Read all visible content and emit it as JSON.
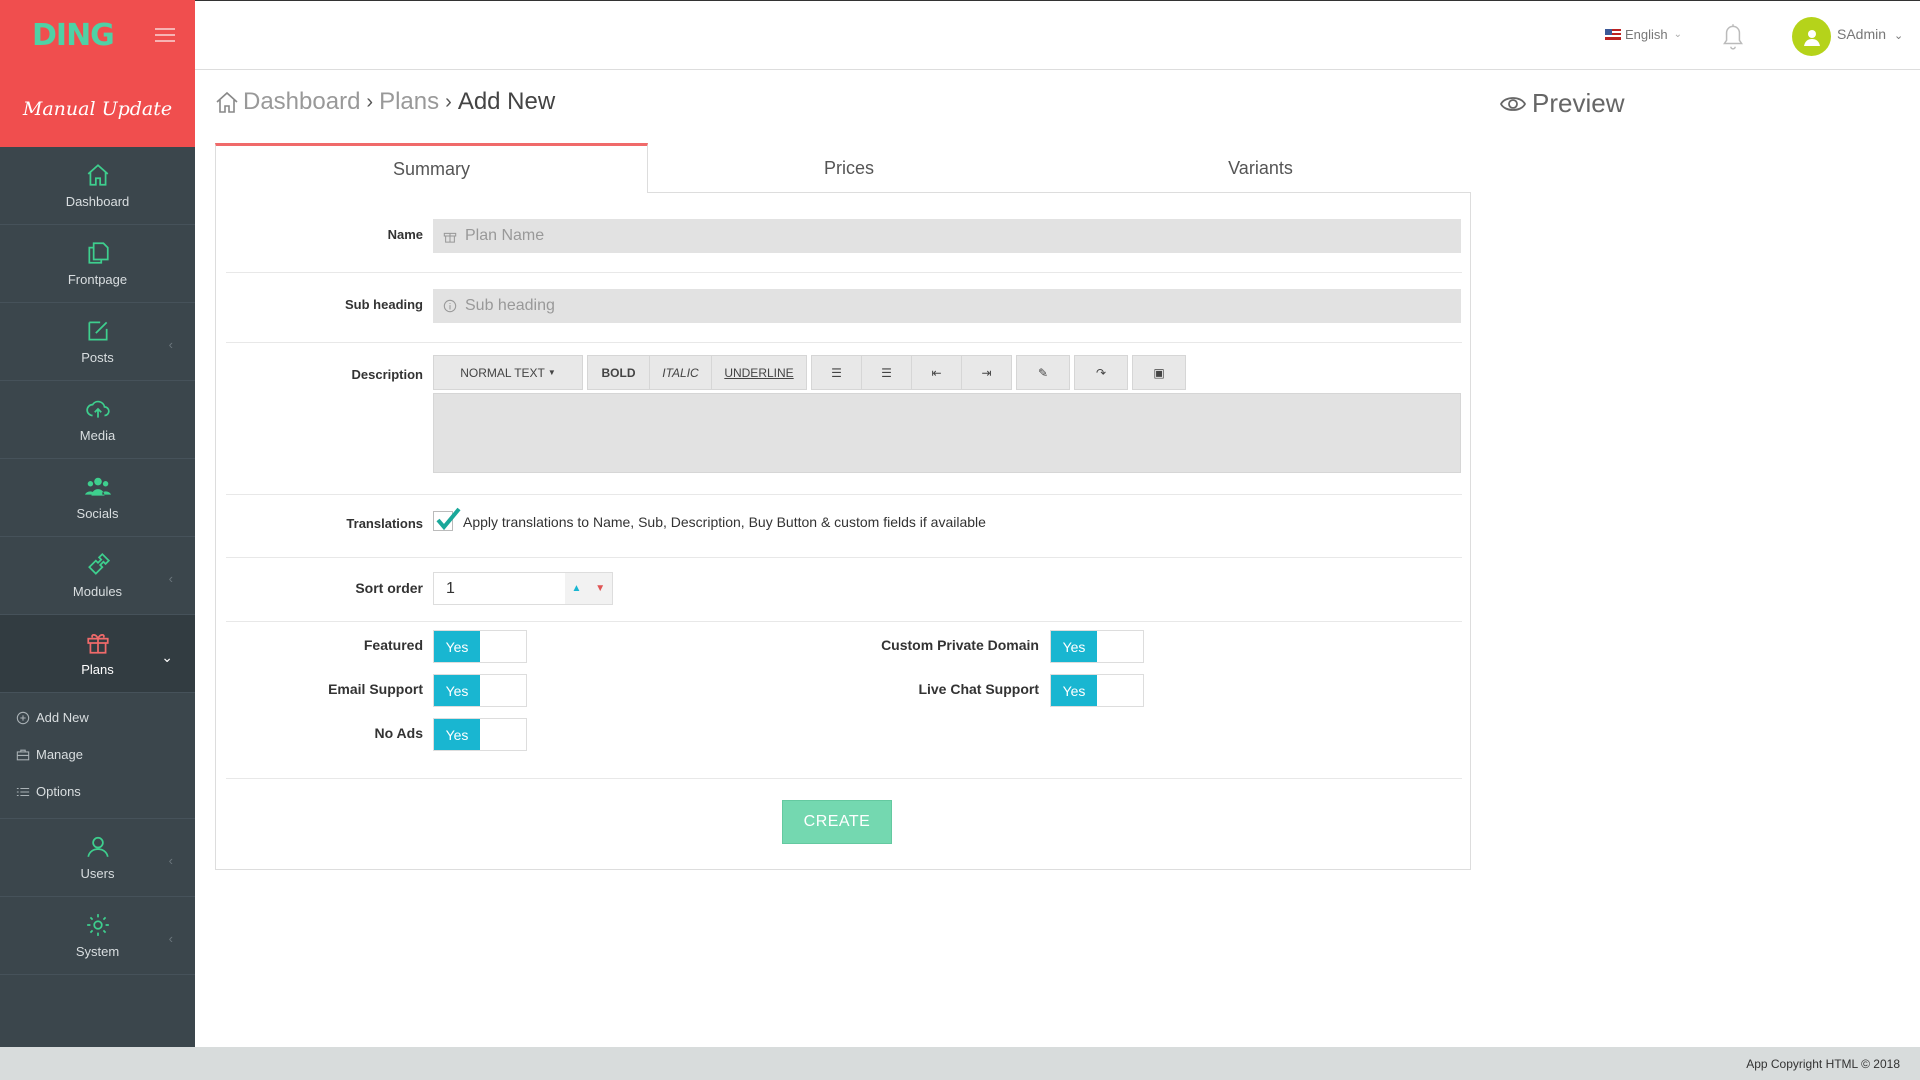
{
  "brand": {
    "logo": "DING",
    "banner": "Manual Update",
    "accent": "#f04e4e",
    "logo_color": "#4fd1a5"
  },
  "sidebar": {
    "items": [
      {
        "label": "Dashboard",
        "icon": "home-icon"
      },
      {
        "label": "Frontpage",
        "icon": "copy-icon"
      },
      {
        "label": "Posts",
        "icon": "edit-icon"
      },
      {
        "label": "Media",
        "icon": "cloud-upload-icon"
      },
      {
        "label": "Socials",
        "icon": "users-group-icon"
      },
      {
        "label": "Modules",
        "icon": "puzzle-icon"
      },
      {
        "label": "Plans",
        "icon": "gift-icon",
        "active": true
      },
      {
        "label": "Users",
        "icon": "user-icon"
      },
      {
        "label": "System",
        "icon": "gear-icon"
      }
    ],
    "plans_submenu": [
      {
        "label": "Add New",
        "icon": "plus-circle-icon"
      },
      {
        "label": "Manage",
        "icon": "briefcase-icon"
      },
      {
        "label": "Options",
        "icon": "list-icon"
      }
    ]
  },
  "header": {
    "language": "English",
    "user": "SAdmin"
  },
  "breadcrumb": {
    "home": "Dashboard",
    "section": "Plans",
    "current": "Add New"
  },
  "preview_label": "Preview",
  "tabs": [
    "Summary",
    "Prices",
    "Variants"
  ],
  "form": {
    "name_label": "Name",
    "name_placeholder": "Plan Name",
    "subheading_label": "Sub heading",
    "subheading_placeholder": "Sub heading",
    "description_label": "Description",
    "toolbar": {
      "normal": "NORMAL TEXT",
      "bold": "BOLD",
      "italic": "ITALIC",
      "underline": "UNDERLINE"
    },
    "translations_label": "Translations",
    "translations_text": "Apply translations to Name, Sub, Description, Buy Button & custom fields if available",
    "translations_checked": true,
    "sort_label": "Sort order",
    "sort_value": "1",
    "toggles": [
      {
        "label": "Featured",
        "value": "Yes"
      },
      {
        "label": "Email Support",
        "value": "Yes"
      },
      {
        "label": "No Ads",
        "value": "Yes"
      },
      {
        "label": "Custom Private Domain",
        "value": "Yes"
      },
      {
        "label": "Live Chat Support",
        "value": "Yes"
      }
    ],
    "submit": "CREATE"
  },
  "footer": "App Copyright HTML © 2018"
}
